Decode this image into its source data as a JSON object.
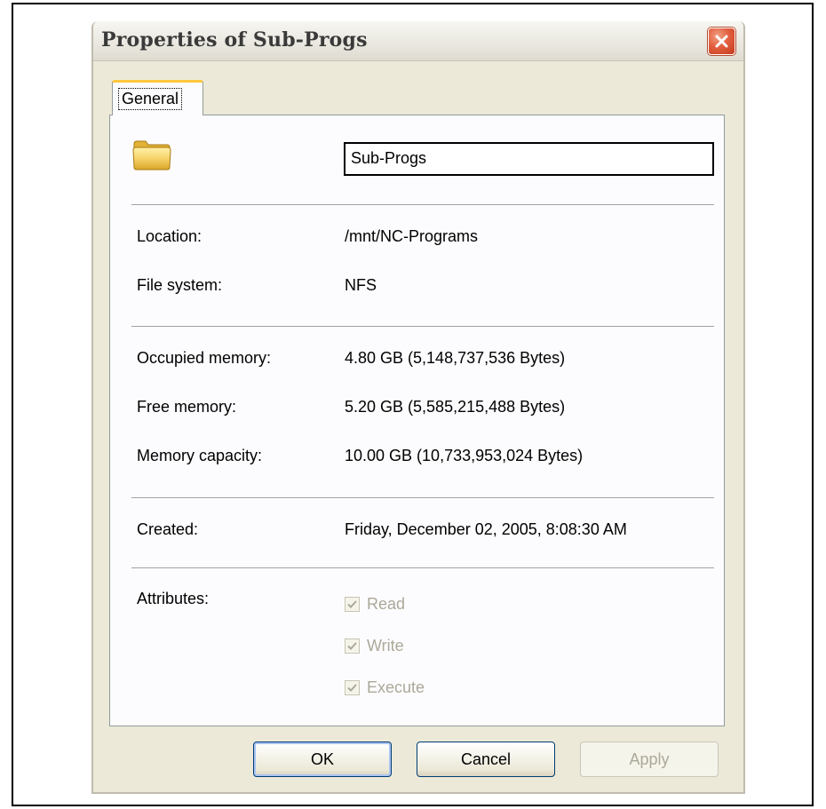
{
  "window": {
    "title": "Properties of Sub-Progs"
  },
  "tabs": [
    {
      "label": "General",
      "active": true
    }
  ],
  "general": {
    "name_value": "Sub-Progs",
    "location_label": "Location:",
    "location_value": "/mnt/NC-Programs",
    "filesystem_label": "File system:",
    "filesystem_value": "NFS",
    "occupied_label": "Occupied memory:",
    "occupied_value": "4.80 GB  (5,148,737,536 Bytes)",
    "free_label": "Free memory:",
    "free_value": "5.20 GB  (5,585,215,488 Bytes)",
    "capacity_label": "Memory capacity:",
    "capacity_value": "10.00 GB  (10,733,953,024 Bytes)",
    "created_label": "Created:",
    "created_value": "Friday, December 02, 2005, 8:08:30 AM",
    "attributes_label": "Attributes:",
    "attributes": [
      {
        "label": "Read",
        "checked": true,
        "enabled": false
      },
      {
        "label": "Write",
        "checked": true,
        "enabled": false
      },
      {
        "label": "Execute",
        "checked": true,
        "enabled": false
      }
    ]
  },
  "buttons": {
    "ok_label": "OK",
    "cancel_label": "Cancel",
    "apply_label": "Apply"
  },
  "colors": {
    "dialog_bg": "#ece9d8",
    "close_button": "#e2603f",
    "tab_highlight": "#ffc83c",
    "disabled_text": "#aca899"
  },
  "icons": {
    "folder": "folder-icon",
    "close": "close-icon",
    "checkmark": "checkmark-icon"
  }
}
